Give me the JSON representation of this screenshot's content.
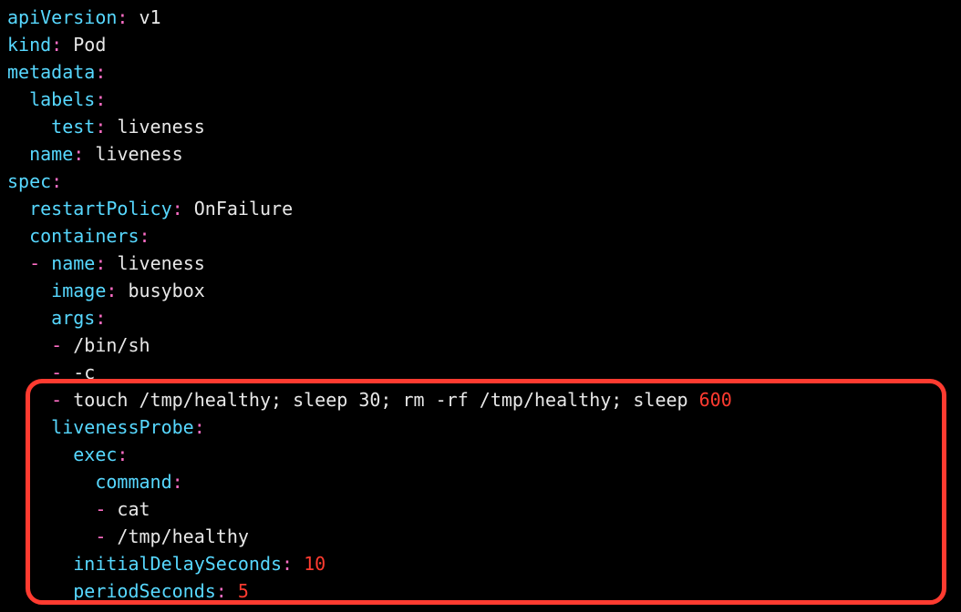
{
  "yaml": {
    "apiVersion": {
      "key": "apiVersion",
      "value": "v1"
    },
    "kind": {
      "key": "kind",
      "value": "Pod"
    },
    "metadataKey": "metadata",
    "labelsKey": "labels",
    "labels": {
      "testKey": "test",
      "testValue": "liveness"
    },
    "metaNameKey": "name",
    "metaNameValue": "liveness",
    "specKey": "spec",
    "restartPolicy": {
      "key": "restartPolicy",
      "value": "OnFailure"
    },
    "containersKey": "containers",
    "c0": {
      "nameKey": "name",
      "nameValue": "liveness",
      "imageKey": "image",
      "imageValue": "busybox",
      "argsKey": "args",
      "arg0": "/bin/sh",
      "arg1": "-c",
      "arg2_pre": "touch /tmp/healthy; sleep 30; rm -rf /tmp/healthy; sleep ",
      "arg2_num": "600",
      "livenessKey": "livenessProbe",
      "execKey": "exec",
      "commandKey": "command",
      "cmd0": "cat",
      "cmd1": "/tmp/healthy",
      "initialDelayKey": "initialDelaySeconds",
      "initialDelayVal": "10",
      "periodKey": "periodSeconds",
      "periodVal": "5"
    }
  },
  "punct": {
    "colon": ":",
    "dash": "-"
  }
}
